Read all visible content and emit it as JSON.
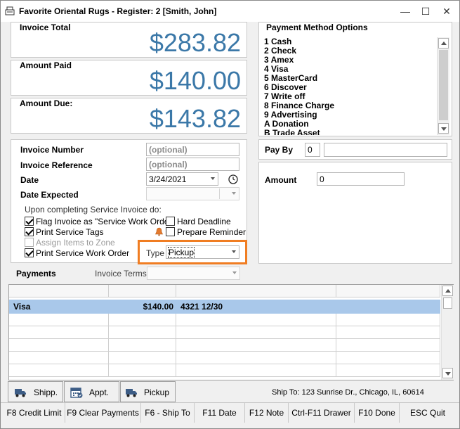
{
  "window": {
    "title": "Favorite Oriental Rugs -  Register: 2  [Smith, John]",
    "buttons": {
      "minimize": "—",
      "maximize": "☐",
      "close": "✕"
    }
  },
  "totals": {
    "invoice_total_label": "Invoice Total",
    "invoice_total": "$283.82",
    "amount_paid_label": "Amount Paid",
    "amount_paid": "$140.00",
    "amount_due_label": "Amount Due:",
    "amount_due": "$143.82"
  },
  "invoice": {
    "number_label": "Invoice Number",
    "number_placeholder": "(optional)",
    "reference_label": "Invoice Reference",
    "reference_placeholder": "(optional)",
    "date_label": "Date",
    "date_value": "3/24/2021",
    "date_expected_label": "Date Expected",
    "date_expected_value": "",
    "completing_label": "Upon completing Service Invoice do:",
    "options": {
      "flag_label": "Flag Invoice as \"Service Work Order\"",
      "flag_checked": true,
      "hard_deadline_label": "Hard Deadline",
      "hard_deadline_checked": false,
      "print_tags_label": "Print Service Tags",
      "print_tags_checked": true,
      "prepare_reminder_label": "Prepare Reminder",
      "prepare_reminder_checked": false,
      "assign_zone_label": "Assign Items to Zone",
      "assign_zone_checked": false,
      "print_work_order_label": "Print Service Work Order",
      "print_work_order_checked": true
    },
    "type_label": "Type",
    "type_value": "Pickup"
  },
  "payment_methods": {
    "title": "Payment Method Options",
    "items": [
      "1 Cash",
      "2 Check",
      "3 Amex",
      "4 Visa",
      "5 MasterCard",
      "6 Discover",
      "7 Write off",
      "8 Finance Charge",
      "9 Advertising",
      "A Donation",
      "B Trade Asset"
    ]
  },
  "pay_by": {
    "label": "Pay By",
    "code": "0",
    "description": ""
  },
  "amount": {
    "label": "Amount",
    "value": "0"
  },
  "payments": {
    "label": "Payments",
    "terms_label": "Invoice Terms",
    "terms_value": "",
    "rows": [
      {
        "method": "Visa",
        "amount": "$140.00",
        "detail": "4321 12/30",
        "extra": ""
      }
    ]
  },
  "bottom_tabs": [
    {
      "label": "Shipp.",
      "icon": "truck-icon"
    },
    {
      "label": "Appt.",
      "icon": "calendar-icon"
    },
    {
      "label": "Pickup",
      "icon": "truck-icon"
    }
  ],
  "ship_to": "Ship To: 123 Sunrise Dr., Chicago, IL, 60614",
  "fkeys": [
    "F8 Credit Limit",
    "F9 Clear Payments",
    "F6 - Ship To",
    "F11 Date",
    "F12 Note",
    "Ctrl-F11 Drawer",
    "F10 Done",
    "ESC Quit"
  ],
  "colors": {
    "amount_blue": "#3b78a8",
    "highlight_row": "#a9c8ea",
    "type_outline": "#f07d22"
  }
}
